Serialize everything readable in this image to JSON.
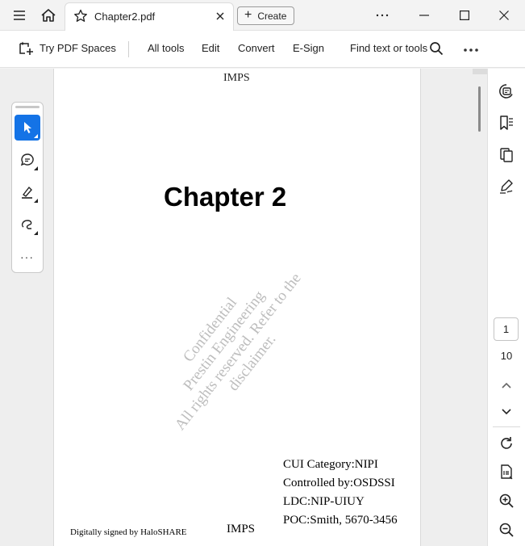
{
  "titlebar": {
    "tab_title": "Chapter2.pdf",
    "create_label": "Create"
  },
  "toolbar": {
    "try_spaces": "Try PDF Spaces",
    "all_tools": "All tools",
    "edit": "Edit",
    "convert": "Convert",
    "esign": "E-Sign",
    "find": "Find text or tools"
  },
  "document": {
    "header": "IMPS",
    "chapter_title": "Chapter 2",
    "watermark_lines": [
      "Confidential",
      "Prestin Engineering",
      "All rights reserved. Refer to the disclaimer."
    ],
    "cui_lines": [
      "CUI Category:NIPI",
      "Controlled by:OSDSSI",
      "LDC:NIP-UIUY",
      "POC:Smith, 5670-3456"
    ],
    "signed": "Digitally signed by HaloSHARE",
    "footer": "IMPS"
  },
  "left_rail": {
    "more": "···"
  },
  "page_nav": {
    "current": "1",
    "total": "10"
  },
  "colors": {
    "accent": "#1473e6"
  }
}
